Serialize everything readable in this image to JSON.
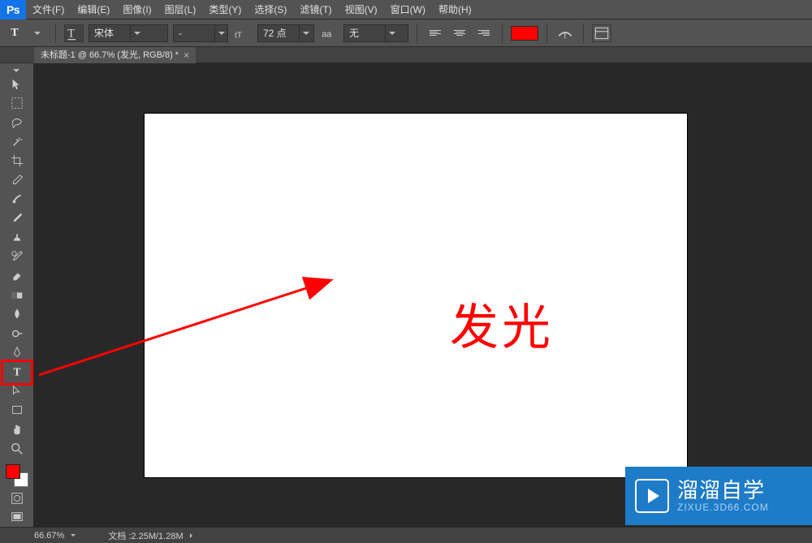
{
  "menu": {
    "logo": "Ps",
    "items": [
      "文件(F)",
      "编辑(E)",
      "图像(I)",
      "图层(L)",
      "类型(Y)",
      "选择(S)",
      "滤镜(T)",
      "视图(V)",
      "窗口(W)",
      "帮助(H)"
    ]
  },
  "options": {
    "tool_letter": "T",
    "font_family": "宋体",
    "font_style": "-",
    "font_size": "72 点",
    "antialias": "无",
    "color": "#ff0000"
  },
  "tab": {
    "title": "未标题-1 @ 66.7% (发光, RGB/8) *"
  },
  "canvas": {
    "text": "发光"
  },
  "status": {
    "zoom": "66.67%",
    "doc": "文档 :2.25M/1.28M"
  },
  "watermark": {
    "title": "溜溜自学",
    "sub": "ZIXUE.3D66.COM"
  }
}
